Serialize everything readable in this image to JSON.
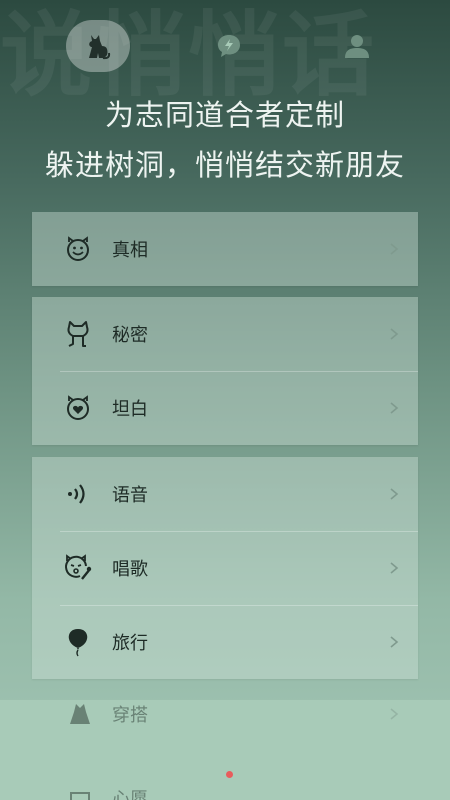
{
  "watermark": "说悄悄话",
  "headline": {
    "line1": "为志同道合者定制",
    "line2": "躲进树洞，悄悄结交新朋友"
  },
  "groups": [
    {
      "items": [
        {
          "label": "真相",
          "icon": "smile-cat-icon"
        }
      ]
    },
    {
      "items": [
        {
          "label": "秘密",
          "icon": "cat-figure-icon"
        },
        {
          "label": "坦白",
          "icon": "heart-cat-icon"
        }
      ]
    },
    {
      "items": [
        {
          "label": "语音",
          "icon": "voice-wave-icon"
        },
        {
          "label": "唱歌",
          "icon": "singing-cat-icon"
        },
        {
          "label": "旅行",
          "icon": "balloon-icon"
        }
      ]
    }
  ],
  "underlay": {
    "item1": "穿搭",
    "item2": "心愿"
  },
  "tabbar": {
    "active": "cat-tab",
    "badge_color": "#e85c5c"
  }
}
